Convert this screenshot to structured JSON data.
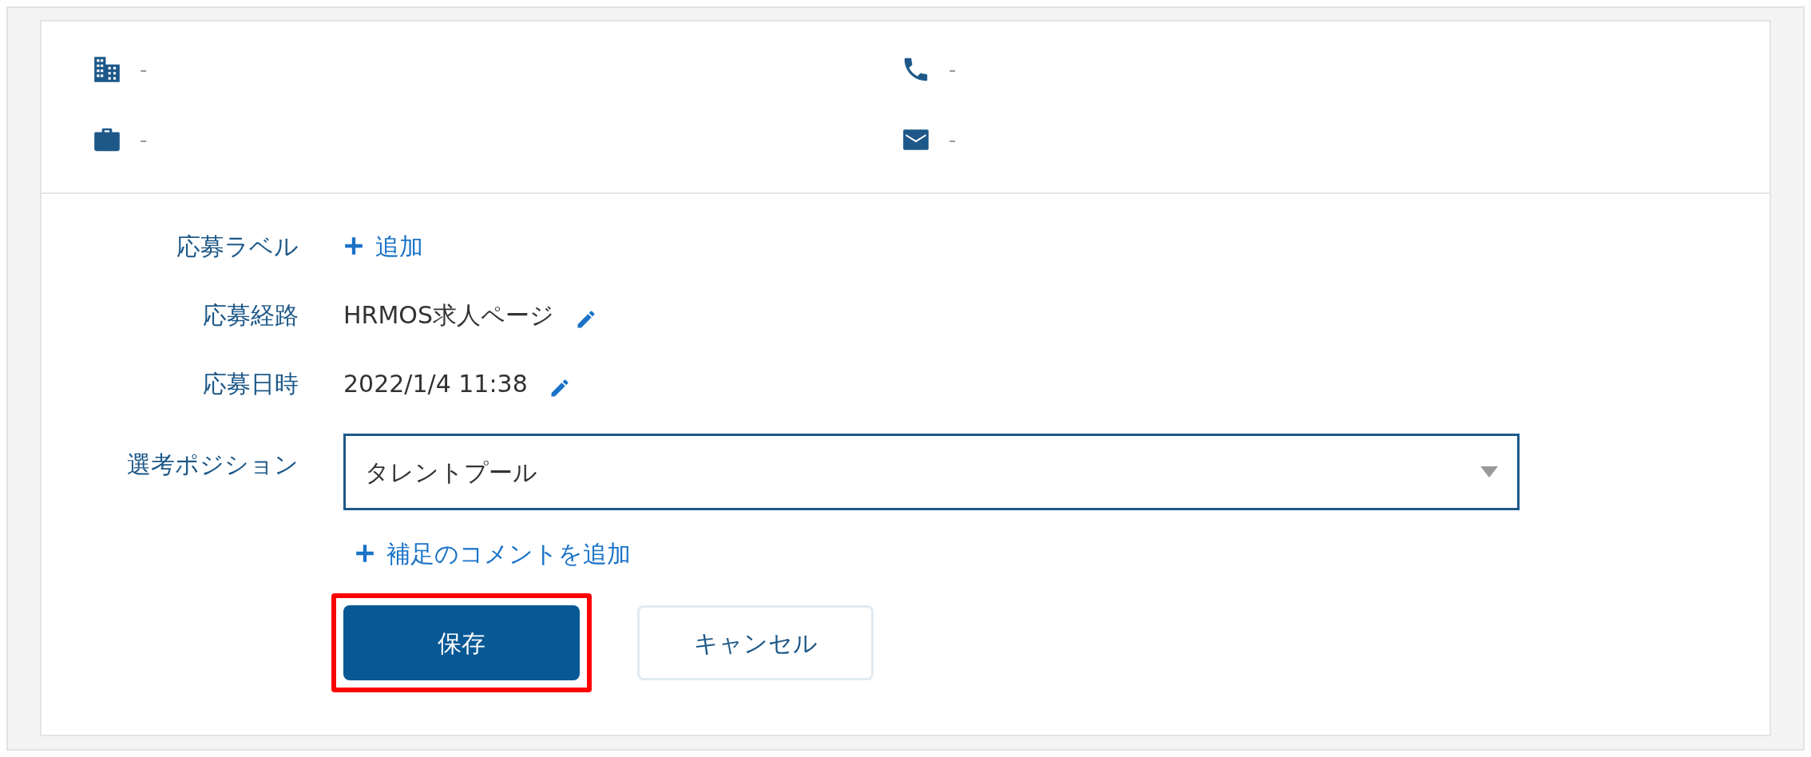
{
  "contact": [
    {
      "kind": "building",
      "value": "-"
    },
    {
      "kind": "phone",
      "value": "-"
    },
    {
      "kind": "briefcase",
      "value": "-"
    },
    {
      "kind": "mail",
      "value": "-"
    }
  ],
  "fields": [
    {
      "label": "応募ラベル",
      "kind": "add",
      "action": "追加"
    },
    {
      "label": "応募経路",
      "kind": "editable",
      "value": "HRMOS求人ページ"
    },
    {
      "label": "応募日時",
      "kind": "editable",
      "value": "2022/1/4 11:38"
    },
    {
      "label": "選考ポジション",
      "kind": "select",
      "value": "タレントプール"
    }
  ],
  "comment_link": "補足のコメントを追加",
  "buttons": [
    {
      "label": "保存",
      "kind": "primary",
      "highlighted": true
    },
    {
      "label": "キャンセル",
      "kind": "secondary",
      "highlighted": false
    }
  ]
}
